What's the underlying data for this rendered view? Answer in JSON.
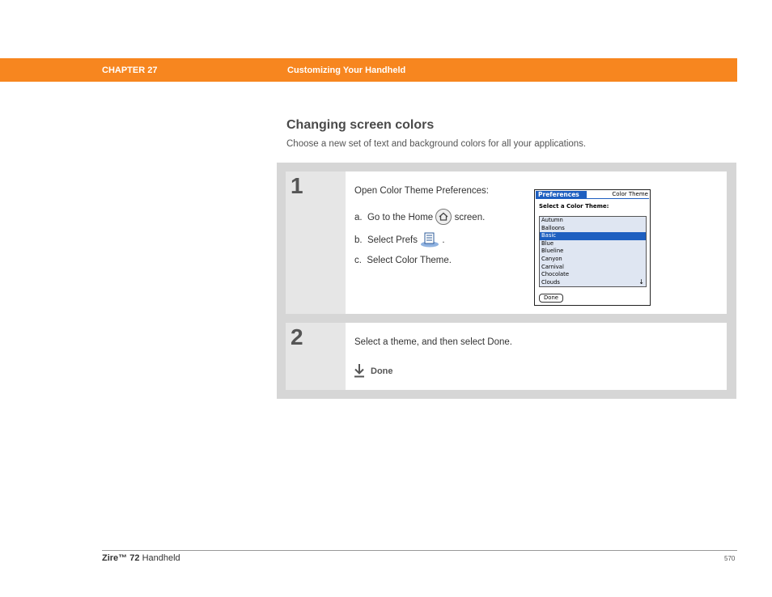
{
  "header": {
    "chapter": "CHAPTER 27",
    "title": "Customizing Your Handheld",
    "color": "#f7861f"
  },
  "section": {
    "title": "Changing screen colors",
    "intro": "Choose a new set of text and background colors for all your applications."
  },
  "steps": [
    {
      "number": "1",
      "lead": "Open Color Theme Preferences:",
      "a_prefix": "a.",
      "a_text": "Go to the Home",
      "a_suffix": "screen.",
      "b_prefix": "b.",
      "b_text": "Select Prefs",
      "b_suffix": ".",
      "c_prefix": "c.",
      "c_text": "Select Color Theme."
    },
    {
      "number": "2",
      "text": "Select a theme, and then select Done.",
      "done_label": "Done"
    }
  ],
  "palm_screen": {
    "tab_title": "Preferences",
    "panel_title": "Color Theme",
    "select_label": "Select a Color Theme:",
    "themes": [
      "Autumn",
      "Balloons",
      "Basic",
      "Blue",
      "Blueline",
      "Canyon",
      "Carnival",
      "Chocolate",
      "Clouds"
    ],
    "selected": "Basic",
    "done_button": "Done"
  },
  "footer": {
    "product_brand": "Zire™",
    "product_model": "72",
    "product_suffix": "Handheld",
    "page_number": "570"
  },
  "icons": [
    "home-icon",
    "prefs-icon",
    "down-arrow-icon",
    "scroll-down-icon"
  ]
}
